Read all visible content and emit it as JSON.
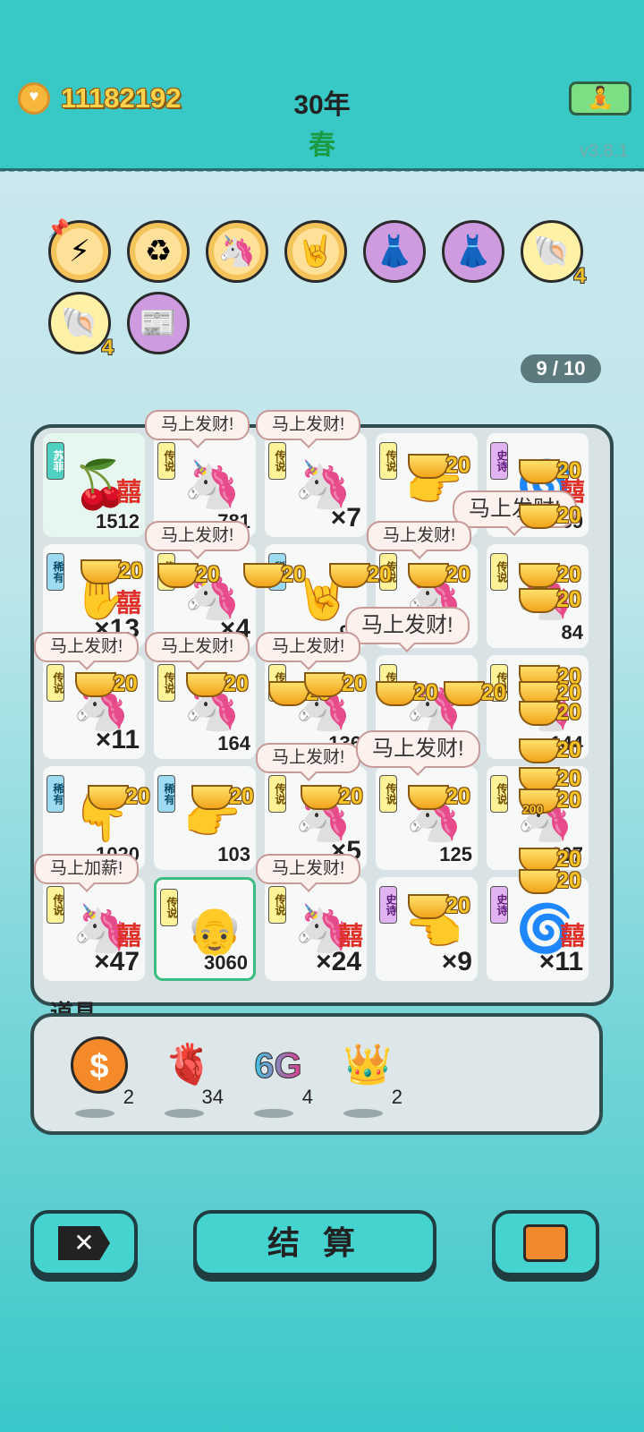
{
  "header": {
    "coins": "11182192",
    "year": "30年",
    "season": "春",
    "version": "v3.8.1",
    "meditate_icon": "meditation-icon"
  },
  "buffs": [
    {
      "icon": "lightning-icon",
      "glyph": "⚡",
      "style": "gold",
      "count": ""
    },
    {
      "icon": "recycle-icon",
      "glyph": "♻",
      "style": "gold",
      "count": ""
    },
    {
      "icon": "unicorn-icon",
      "glyph": "🦄",
      "style": "gold",
      "count": ""
    },
    {
      "icon": "rock-hand-icon",
      "glyph": "🤘",
      "style": "gold",
      "count": ""
    },
    {
      "icon": "skirt-icon",
      "glyph": "👗",
      "style": "purple",
      "count": ""
    },
    {
      "icon": "skirt-icon",
      "glyph": "👗",
      "style": "purple",
      "count": ""
    },
    {
      "icon": "shell-icon",
      "glyph": "🐚",
      "style": "yellow",
      "count": "4"
    },
    {
      "icon": "shell-icon",
      "glyph": "🐚",
      "style": "yellow",
      "count": "4"
    },
    {
      "icon": "time-magazine-icon",
      "glyph": "📰",
      "style": "purple",
      "count": ""
    }
  ],
  "spin_counter": "9 / 10",
  "board": {
    "cells": [
      {
        "rarity": "苏菲",
        "rclass": "mythic",
        "icon": "cherries-icon",
        "glyph": "🍒",
        "xi": "囍",
        "value": "1512"
      },
      {
        "rarity": "传说",
        "rclass": "leg",
        "icon": "unicorn-icon",
        "glyph": "🦄",
        "xi": "",
        "value": "781"
      },
      {
        "rarity": "传说",
        "rclass": "leg",
        "icon": "unicorn-icon",
        "glyph": "🦄",
        "xi": "",
        "value": "×7"
      },
      {
        "rarity": "传说",
        "rclass": "leg",
        "icon": "hand-icon",
        "glyph": "👉",
        "xi": "",
        "value": ""
      },
      {
        "rarity": "史诗",
        "rclass": "epic",
        "icon": "fan-icon",
        "glyph": "🌀",
        "xi": "囍",
        "value": "59"
      },
      {
        "rarity": "稀有",
        "rclass": "rare",
        "icon": "hand-icon",
        "glyph": "✋",
        "xi": "囍",
        "value": "×13"
      },
      {
        "rarity": "传说",
        "rclass": "leg",
        "icon": "unicorn-icon",
        "glyph": "🦄",
        "xi": "",
        "value": "×4"
      },
      {
        "rarity": "稀有",
        "rclass": "rare",
        "icon": "hand-icon",
        "glyph": "🤘",
        "xi": "",
        "value": "98"
      },
      {
        "rarity": "传说",
        "rclass": "leg",
        "icon": "unicorn-icon",
        "glyph": "🦄",
        "xi": "",
        "value": ""
      },
      {
        "rarity": "传说",
        "rclass": "leg",
        "icon": "unicorn-icon",
        "glyph": "🦄",
        "xi": "",
        "value": "84"
      },
      {
        "rarity": "传说",
        "rclass": "leg",
        "icon": "unicorn-icon",
        "glyph": "🦄",
        "xi": "",
        "value": "×11"
      },
      {
        "rarity": "传说",
        "rclass": "leg",
        "icon": "unicorn-icon",
        "glyph": "🦄",
        "xi": "",
        "value": "164"
      },
      {
        "rarity": "传说",
        "rclass": "leg",
        "icon": "unicorn-icon",
        "glyph": "🦄",
        "xi": "",
        "value": "136"
      },
      {
        "rarity": "传说",
        "rclass": "leg",
        "icon": "unicorn-icon",
        "glyph": "🦄",
        "xi": "",
        "value": ""
      },
      {
        "rarity": "传说",
        "rclass": "leg",
        "icon": "unicorn-icon",
        "glyph": "🦄",
        "xi": "",
        "value": "144"
      },
      {
        "rarity": "稀有",
        "rclass": "rare",
        "icon": "hand-icon",
        "glyph": "👇",
        "xi": "",
        "value": "1020"
      },
      {
        "rarity": "稀有",
        "rclass": "rare",
        "icon": "hand-icon",
        "glyph": "👉",
        "xi": "",
        "value": "103"
      },
      {
        "rarity": "传说",
        "rclass": "leg",
        "icon": "unicorn-icon",
        "glyph": "🦄",
        "xi": "",
        "value": "×5"
      },
      {
        "rarity": "传说",
        "rclass": "leg",
        "icon": "unicorn-icon",
        "glyph": "🦄",
        "xi": "",
        "value": "125"
      },
      {
        "rarity": "传说",
        "rclass": "leg",
        "icon": "unicorn-icon",
        "glyph": "🦄",
        "xi": "",
        "value": "207"
      },
      {
        "rarity": "传说",
        "rclass": "leg",
        "icon": "unicorn-icon",
        "glyph": "🦄",
        "xi": "囍",
        "value": "×47"
      },
      {
        "rarity": "传说",
        "rclass": "leg",
        "icon": "bald-man-icon",
        "glyph": "👴",
        "xi": "",
        "value": "3060"
      },
      {
        "rarity": "传说",
        "rclass": "leg",
        "icon": "unicorn-icon",
        "glyph": "🦄",
        "xi": "囍",
        "value": "×24"
      },
      {
        "rarity": "史诗",
        "rclass": "epic",
        "icon": "hand-icon",
        "glyph": "👈",
        "xi": "",
        "value": "×9"
      },
      {
        "rarity": "史诗",
        "rclass": "epic",
        "icon": "fan-icon",
        "glyph": "🌀",
        "xi": "囍",
        "value": "×11"
      }
    ],
    "bubbles": [
      "马上发财!",
      "马上发财!",
      "马上发财!",
      "马上发财!",
      "马上发财!",
      "马上发财!",
      "马上发财!",
      "马上发财!",
      "马上发财!",
      "马上发财!",
      "马上发财!",
      "马上发财!",
      "马上加薪!",
      "马上发财!"
    ],
    "ingot_value": "20",
    "ingot_small": "200"
  },
  "items": {
    "title": "道具",
    "list": [
      {
        "icon": "dollar-coin-icon",
        "glyph": "$",
        "count": "2"
      },
      {
        "icon": "liver-icon",
        "glyph": "🫀",
        "count": "34"
      },
      {
        "icon": "6g-icon",
        "glyph": "6G",
        "count": "4"
      },
      {
        "icon": "crown-icon",
        "glyph": "👑",
        "count": "2"
      }
    ]
  },
  "buttons": {
    "cancel_icon": "close-icon",
    "settle_label": "结 算",
    "bag_icon": "briefcase-icon"
  }
}
